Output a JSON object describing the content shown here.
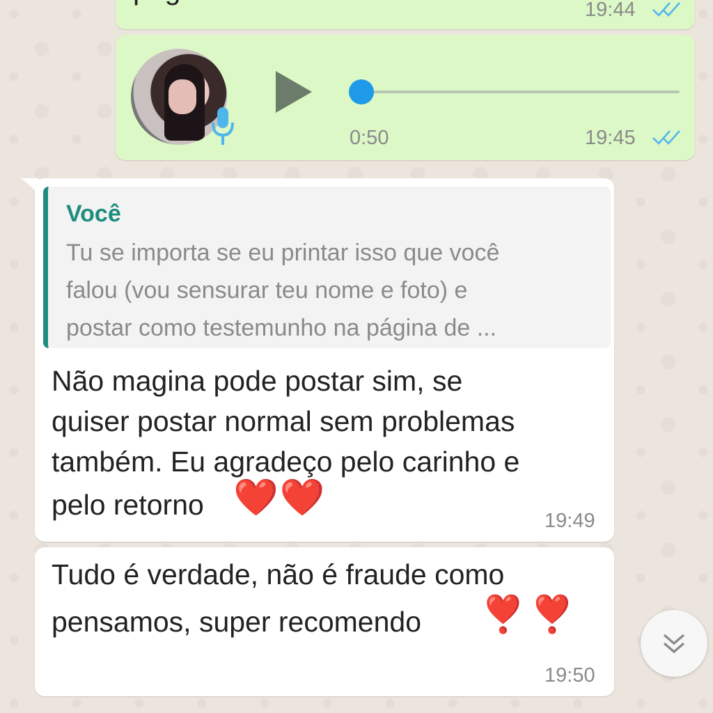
{
  "chat": {
    "msg1": {
      "text_fragment": "página de venda?",
      "time": "19:44",
      "status_icon": "double-check-read-icon"
    },
    "voice": {
      "duration": "0:50",
      "time": "19:45",
      "progress": 0,
      "status_icon": "double-check-read-icon",
      "avatar_icon": "sender-avatar",
      "mic_icon": "mic-icon",
      "play_icon": "play-icon"
    },
    "reply": {
      "quote_author": "Você",
      "quote_lines": [
        "Tu se importa se eu printar isso que você",
        "falou (vou sensurar teu nome e foto) e",
        "postar como testemunho na página de ..."
      ],
      "lines": [
        "Não magina pode postar sim, se",
        "quiser postar normal sem problemas",
        "também. Eu agradeço pelo carinho e",
        "pelo retorno"
      ],
      "emoji": "❤️❤️",
      "time": "19:49"
    },
    "msg4": {
      "lines": [
        "Tudo é verdade, não é fraude como",
        "pensamos, super recomendo"
      ],
      "emoji": "❣️❣️",
      "time": "19:50"
    },
    "scroll_button_icon": "chevron-double-down-icon"
  },
  "colors": {
    "wallpaper": "#ece5dd",
    "outgoing": "#dcf8c6",
    "incoming": "#ffffff",
    "accent_teal": "#1e8c7e",
    "read_blue": "#4fb6ec",
    "play_grey": "#6b7d6a"
  }
}
